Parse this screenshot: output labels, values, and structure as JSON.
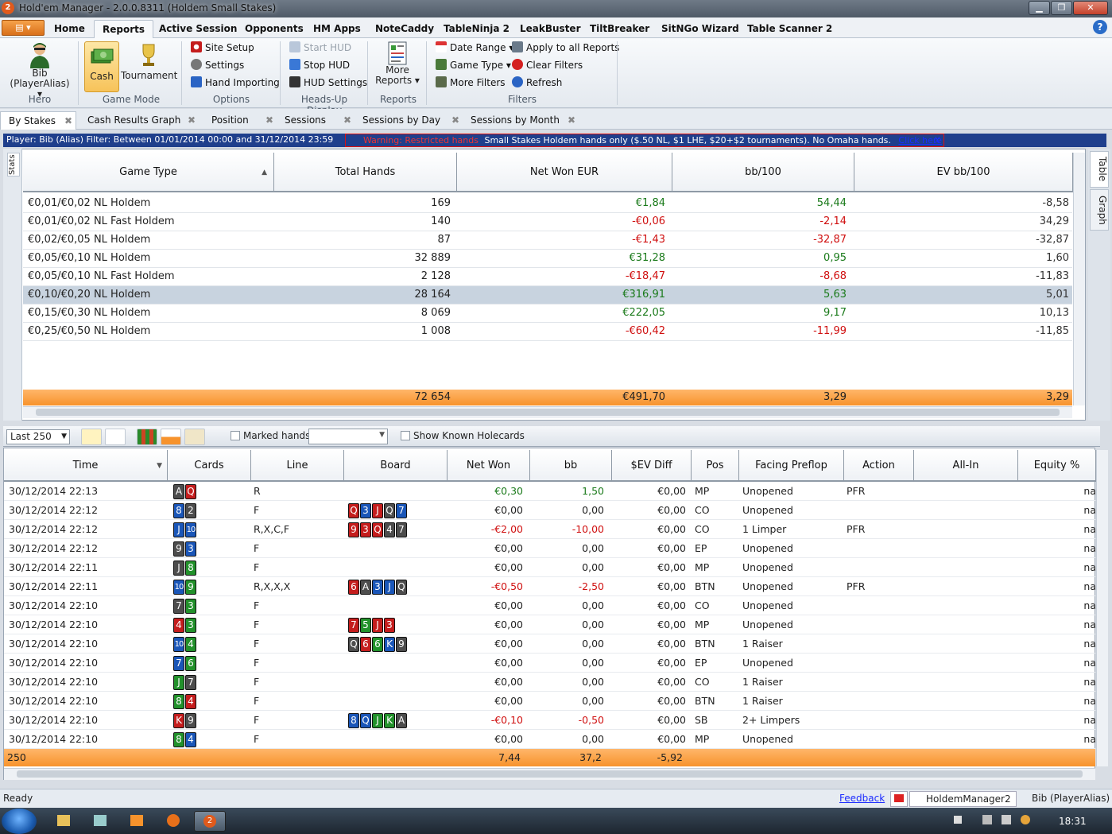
{
  "window": {
    "title": "Hold'em Manager - 2.0.0.8311 (Holdem Small Stakes)",
    "app_badge": "2"
  },
  "menu": {
    "tabs": [
      "Home",
      "Reports",
      "Active Session",
      "Opponents",
      "HM Apps",
      "NoteCaddy",
      "TableNinja 2",
      "LeakBuster",
      "TiltBreaker",
      "SitNGo Wizard",
      "Table Scanner 2"
    ],
    "active": "Reports",
    "help": "?"
  },
  "ribbon": {
    "hero": {
      "name_line1": "Bib",
      "name_line2": "(PlayerAlias) ▾",
      "label": "Hero"
    },
    "game_mode": {
      "cash": "Cash",
      "tournament": "Tournament",
      "label": "Game Mode"
    },
    "options": {
      "site_setup": "Site Setup",
      "settings": "Settings",
      "hand_importing": "Hand Importing",
      "label": "Options"
    },
    "hud": {
      "start": "Start HUD",
      "stop": "Stop HUD",
      "settings": "HUD Settings",
      "label": "Heads-Up Display"
    },
    "reports": {
      "more_line1": "More",
      "more_line2": "Reports ▾",
      "label": "Reports"
    },
    "filters": {
      "date_range": "Date Range ▾",
      "game_type": "Game Type ▾",
      "more_filters": "More Filters",
      "apply_all": "Apply to all Reports",
      "clear": "Clear Filters",
      "refresh": "Refresh",
      "label": "Filters"
    }
  },
  "report_tabs": [
    "By Stakes",
    "Cash Results Graph",
    "Position",
    "Sessions",
    "Sessions by Day",
    "Sessions by Month"
  ],
  "filter_bar": {
    "player": "Player: Bib (Alias)   Filter: Between 01/01/2014 00:00 and 31/12/2014 23:59",
    "warning": "Warning: Restricted hands",
    "warning_text": "Small Stakes Holdem hands only ($.50 NL, $1 LHE, $20+$2 tournaments).  No Omaha hands.",
    "unlock": "Click here to unlock",
    "close": "X"
  },
  "stats": {
    "side_tab": "Stats",
    "headers": [
      "Game Type",
      "Total Hands",
      "Net Won EUR",
      "bb/100",
      "EV bb/100"
    ],
    "rows": [
      {
        "game": "€0,01/€0,02 NL Holdem",
        "hands": "169",
        "net": "€1,84",
        "bb": "54,44",
        "ev": "-8,58"
      },
      {
        "game": "€0,01/€0,02 NL Fast Holdem",
        "hands": "140",
        "net": "-€0,06",
        "bb": "-2,14",
        "ev": "34,29"
      },
      {
        "game": "€0,02/€0,05 NL Holdem",
        "hands": "87",
        "net": "-€1,43",
        "bb": "-32,87",
        "ev": "-32,87"
      },
      {
        "game": "€0,05/€0,10 NL Holdem",
        "hands": "32 889",
        "net": "€31,28",
        "bb": "0,95",
        "ev": "1,60"
      },
      {
        "game": "€0,05/€0,10 NL Fast Holdem",
        "hands": "2 128",
        "net": "-€18,47",
        "bb": "-8,68",
        "ev": "-11,83"
      },
      {
        "game": "€0,10/€0,20 NL Holdem",
        "hands": "28 164",
        "net": "€316,91",
        "bb": "5,63",
        "ev": "5,01"
      },
      {
        "game": "€0,15/€0,30 NL Holdem",
        "hands": "8 069",
        "net": "€222,05",
        "bb": "9,17",
        "ev": "10,13"
      },
      {
        "game": "€0,25/€0,50 NL Holdem",
        "hands": "1 008",
        "net": "-€60,42",
        "bb": "-11,99",
        "ev": "-11,85"
      }
    ],
    "selected_row": 5,
    "total": {
      "hands": "72 654",
      "net": "€491,70",
      "bb": "3,29",
      "ev": "3,29"
    },
    "right_tabs": [
      "Table",
      "Graph"
    ]
  },
  "hands_toolbar": {
    "last": "Last 250",
    "marked": "Marked hands",
    "known": "Show Known Holecards"
  },
  "hands": {
    "headers": [
      "Time",
      "Cards",
      "Line",
      "Board",
      "Net Won",
      "bb",
      "$EV Diff",
      "Pos",
      "Facing Preflop",
      "Action",
      "All-In",
      "Equity %"
    ],
    "rows": [
      {
        "time": "30/12/2014 22:13",
        "cards": [
          [
            "A",
            "s"
          ],
          [
            "Q",
            "h"
          ]
        ],
        "line": "R",
        "board": [],
        "net": "€0,30",
        "bb": "1,50",
        "ev": "€0,00",
        "pos": "MP",
        "facing": "Unopened",
        "action": "PFR",
        "allin": "",
        "eq": "na"
      },
      {
        "time": "30/12/2014 22:12",
        "cards": [
          [
            "8",
            "d"
          ],
          [
            "2",
            "s"
          ]
        ],
        "line": "F",
        "board": [
          [
            "Q",
            "h"
          ],
          [
            "3",
            "d"
          ],
          [
            "J",
            "h"
          ],
          [
            "Q",
            "s"
          ],
          [
            "7",
            "d"
          ]
        ],
        "net": "€0,00",
        "bb": "0,00",
        "ev": "€0,00",
        "pos": "CO",
        "facing": "Unopened",
        "action": "",
        "allin": "",
        "eq": "na"
      },
      {
        "time": "30/12/2014 22:12",
        "cards": [
          [
            "J",
            "d"
          ],
          [
            "10",
            "d"
          ]
        ],
        "line": "R,X,C,F",
        "board": [
          [
            "9",
            "h"
          ],
          [
            "3",
            "h"
          ],
          [
            "Q",
            "h"
          ],
          [
            "4",
            "s"
          ],
          [
            "7",
            "s"
          ]
        ],
        "net": "-€2,00",
        "bb": "-10,00",
        "ev": "€0,00",
        "pos": "CO",
        "facing": "1 Limper",
        "action": "PFR",
        "allin": "",
        "eq": "na"
      },
      {
        "time": "30/12/2014 22:12",
        "cards": [
          [
            "9",
            "s"
          ],
          [
            "3",
            "d"
          ]
        ],
        "line": "F",
        "board": [],
        "net": "€0,00",
        "bb": "0,00",
        "ev": "€0,00",
        "pos": "EP",
        "facing": "Unopened",
        "action": "",
        "allin": "",
        "eq": "na"
      },
      {
        "time": "30/12/2014 22:11",
        "cards": [
          [
            "J",
            "s"
          ],
          [
            "8",
            "c"
          ]
        ],
        "line": "F",
        "board": [],
        "net": "€0,00",
        "bb": "0,00",
        "ev": "€0,00",
        "pos": "MP",
        "facing": "Unopened",
        "action": "",
        "allin": "",
        "eq": "na"
      },
      {
        "time": "30/12/2014 22:11",
        "cards": [
          [
            "10",
            "d"
          ],
          [
            "9",
            "c"
          ]
        ],
        "line": "R,X,X,X",
        "board": [
          [
            "6",
            "h"
          ],
          [
            "A",
            "s"
          ],
          [
            "3",
            "d"
          ],
          [
            "J",
            "d"
          ],
          [
            "Q",
            "s"
          ]
        ],
        "net": "-€0,50",
        "bb": "-2,50",
        "ev": "€0,00",
        "pos": "BTN",
        "facing": "Unopened",
        "action": "PFR",
        "allin": "",
        "eq": "na"
      },
      {
        "time": "30/12/2014 22:10",
        "cards": [
          [
            "7",
            "s"
          ],
          [
            "3",
            "c"
          ]
        ],
        "line": "F",
        "board": [],
        "net": "€0,00",
        "bb": "0,00",
        "ev": "€0,00",
        "pos": "CO",
        "facing": "Unopened",
        "action": "",
        "allin": "",
        "eq": "na"
      },
      {
        "time": "30/12/2014 22:10",
        "cards": [
          [
            "4",
            "h"
          ],
          [
            "3",
            "c"
          ]
        ],
        "line": "F",
        "board": [
          [
            "7",
            "h"
          ],
          [
            "5",
            "c"
          ],
          [
            "J",
            "h"
          ],
          [
            "3",
            "h"
          ]
        ],
        "net": "€0,00",
        "bb": "0,00",
        "ev": "€0,00",
        "pos": "MP",
        "facing": "Unopened",
        "action": "",
        "allin": "",
        "eq": "na"
      },
      {
        "time": "30/12/2014 22:10",
        "cards": [
          [
            "10",
            "d"
          ],
          [
            "4",
            "c"
          ]
        ],
        "line": "F",
        "board": [
          [
            "Q",
            "s"
          ],
          [
            "6",
            "h"
          ],
          [
            "6",
            "c"
          ],
          [
            "K",
            "d"
          ],
          [
            "9",
            "s"
          ]
        ],
        "net": "€0,00",
        "bb": "0,00",
        "ev": "€0,00",
        "pos": "BTN",
        "facing": "1 Raiser",
        "action": "",
        "allin": "",
        "eq": "na"
      },
      {
        "time": "30/12/2014 22:10",
        "cards": [
          [
            "7",
            "d"
          ],
          [
            "6",
            "c"
          ]
        ],
        "line": "F",
        "board": [],
        "net": "€0,00",
        "bb": "0,00",
        "ev": "€0,00",
        "pos": "EP",
        "facing": "Unopened",
        "action": "",
        "allin": "",
        "eq": "na"
      },
      {
        "time": "30/12/2014 22:10",
        "cards": [
          [
            "J",
            "c"
          ],
          [
            "7",
            "s"
          ]
        ],
        "line": "F",
        "board": [],
        "net": "€0,00",
        "bb": "0,00",
        "ev": "€0,00",
        "pos": "CO",
        "facing": "1 Raiser",
        "action": "",
        "allin": "",
        "eq": "na"
      },
      {
        "time": "30/12/2014 22:10",
        "cards": [
          [
            "8",
            "c"
          ],
          [
            "4",
            "h"
          ]
        ],
        "line": "F",
        "board": [],
        "net": "€0,00",
        "bb": "0,00",
        "ev": "€0,00",
        "pos": "BTN",
        "facing": "1 Raiser",
        "action": "",
        "allin": "",
        "eq": "na"
      },
      {
        "time": "30/12/2014 22:10",
        "cards": [
          [
            "K",
            "h"
          ],
          [
            "9",
            "s"
          ]
        ],
        "line": "F",
        "board": [
          [
            "8",
            "d"
          ],
          [
            "Q",
            "d"
          ],
          [
            "J",
            "c"
          ],
          [
            "K",
            "c"
          ],
          [
            "A",
            "s"
          ]
        ],
        "net": "-€0,10",
        "bb": "-0,50",
        "ev": "€0,00",
        "pos": "SB",
        "facing": "2+ Limpers",
        "action": "",
        "allin": "",
        "eq": "na"
      },
      {
        "time": "30/12/2014 22:10",
        "cards": [
          [
            "8",
            "c"
          ],
          [
            "4",
            "d"
          ]
        ],
        "line": "F",
        "board": [],
        "net": "€0,00",
        "bb": "0,00",
        "ev": "€0,00",
        "pos": "MP",
        "facing": "Unopened",
        "action": "",
        "allin": "",
        "eq": "na"
      }
    ],
    "total": {
      "count": "250",
      "net": "7,44",
      "bb": "37,2",
      "ev": "-5,92"
    }
  },
  "status": {
    "ready": "Ready",
    "feedback": "Feedback",
    "app": "HoldemManager2",
    "player": "Bib (PlayerAlias)"
  },
  "taskbar": {
    "clock": "18:31"
  }
}
